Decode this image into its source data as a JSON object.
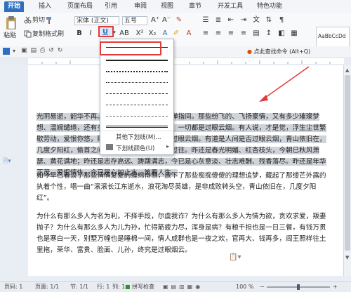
{
  "menu_tabs": [
    {
      "label": "开始",
      "active": true
    },
    {
      "label": "插入",
      "active": false
    },
    {
      "label": "页面布局",
      "active": false
    },
    {
      "label": "引用",
      "active": false
    },
    {
      "label": "审阅",
      "active": false
    },
    {
      "label": "视图",
      "active": false
    },
    {
      "label": "章节",
      "active": false
    },
    {
      "label": "开发工具",
      "active": false
    },
    {
      "label": "特色功能",
      "active": false
    }
  ],
  "ribbon": {
    "paste_label": "粘贴",
    "cut_label": "剪切",
    "copy_label": "复制",
    "format_painter_label": "格式刷",
    "font_name": "宋体 (正文)",
    "font_size": "五号",
    "underline_label": "U",
    "style_preview": "AaBbCcDd",
    "style_name": "正文"
  },
  "quickbar": {
    "search_text": "点此查找命令 (Alt+Q)"
  },
  "document": {
    "paragraphs": [
      {
        "text": "光阴易逝，韶华不再。时光如白驹过隙，仿佛弹指间。那些纷飞的、飞扬豪情，又有多少璀璨梦想、温婉缱绻，还有多少恩恩怨怨皆随风而逝，一切都是过眼云烟。有人说，才是觉，浮生尘世繁歇劳动，爱恨你悠，财色空空，所有一切只是过眼云烟。有道是人间是否过眼云烟，青山依旧在，几度夕阳红，偷首之间，已是一去千里，永成过往。昨还是春光明媚、红杏枝头，今朝已秋风萧瑟、黄花满地；昨还是志存高远、踌躇满志，今已是心灰意淡、壮志难酬、残香落尽。昨还是年华正茂、爱恨情仇，今已是心如止水、笑看人生。",
        "highlighted": true
      },
      {
        "text": "如今早已看淡了那些情情爱爱的缠绵悱恻，放下了那些痴痴傻傻的理想追梦，藏起了那缕芒外露的执着个性，唱一曲“滚滚长江东逝水，浪花淘尽英雄，是非成败转头空，青山依旧在，几度夕阳红”。",
        "highlighted": false
      },
      {
        "text": "为什么有那么多人为名为利，不择手段，尔虞我诈？为什么有那么多人为情为欲，贪欢求爱，叛妻抛子？为什么有那么多人为儿为孙，忙得筋疲力尽，浑身是病？有粮千担也是一日三餐，有钱万贯也是寒白一天，别墅万幢也是睡棉一间，情人成群也是一夜之欢，官再大、钱再多，阎王照样往土里拖，荣华、富贵、脸面、儿孙，终究是过眼烟云。",
        "highlighted": false
      }
    ]
  },
  "dropdown": {
    "styles": [
      "solid",
      "thick",
      "dotted",
      "dotted-fine",
      "dashed",
      "dash-dot",
      "dash-dot-dot",
      "double"
    ],
    "more_label": "其他下划线(M)...",
    "color_label": "下划线颜色(U)"
  },
  "status": {
    "page_label": "页码: 1",
    "pages_label": "页面: 1/1",
    "section_label": "节: 1/1",
    "row_label": "行: 1",
    "col_label": "列: 1",
    "spell_label": "拼写检查",
    "zoom": "100 %"
  },
  "colors": {
    "accent": "#2f6fbf",
    "highlight": "#cfd3da",
    "callout": "#e23b3b"
  }
}
